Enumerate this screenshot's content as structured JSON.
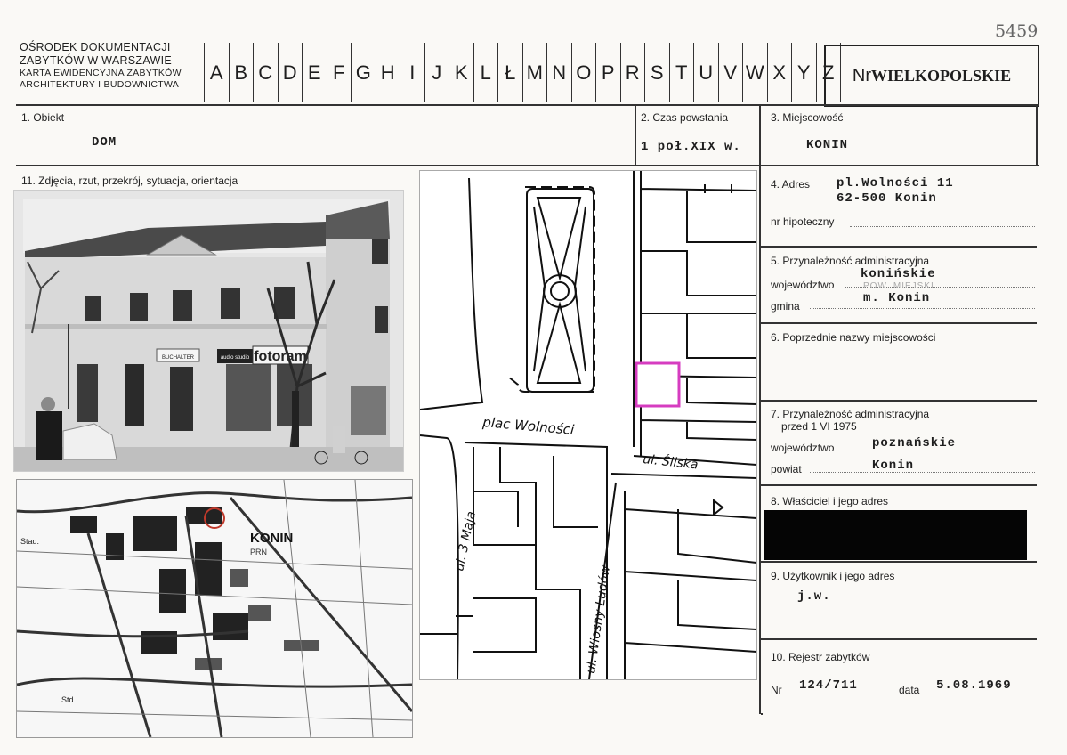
{
  "corner_number": "5459",
  "header": {
    "institution_line1": "OŚRODEK DOKUMENTACJI",
    "institution_line2": "ZABYTKÓW W WARSZAWIE",
    "institution_line3": "KARTA EWIDENCYJNA ZABYTKÓW",
    "institution_line4": "ARCHITEKTURY I BUDOWNICTWA",
    "letters": [
      "A",
      "B",
      "C",
      "D",
      "E",
      "F",
      "G",
      "H",
      "I",
      "J",
      "K",
      "L",
      "Ł",
      "M",
      "N",
      "O",
      "P",
      "R",
      "S",
      "T",
      "U",
      "V",
      "W",
      "X",
      "Y",
      "Z"
    ],
    "nr_label": "Nr",
    "nr_value": "WIELKOPOLSKIE"
  },
  "fields": {
    "obiekt_label": "1. Obiekt",
    "obiekt_value": "DOM",
    "czas_label": "2. Czas powstania",
    "czas_value": "1 poł.XIX w.",
    "miejscowosc_label": "3. Miejscowość",
    "miejscowosc_value": "KONIN",
    "zdjecia_label": "11. Zdjęcia, rzut, przekrój, sytuacja, orientacja",
    "adres_label": "4. Adres",
    "adres_line1": "pl.Wolności 11",
    "adres_line2": "62-500 Konin",
    "hipoteczny_label": "nr hipoteczny",
    "admin_label": "5. Przynależność administracyjna",
    "wojewodztwo_label": "województwo",
    "wojewodztwo_value": "konińskie",
    "gmina_label": "gmina",
    "gmina_note": "POW. MIEJSKI",
    "gmina_value": "m. Konin",
    "poprzednie_label": "6. Poprzednie nazwy miejscowości",
    "admin75_label_line1": "7. Przynależność administracyjna",
    "admin75_label_line2": "przed 1 VI 1975",
    "wojewodztwo75_label": "województwo",
    "wojewodztwo75_value": "poznańskie",
    "powiat_label": "powiat",
    "powiat_value": "Konin",
    "wlasciciel_label": "8. Właściciel i jego adres",
    "uzytkownik_label": "9. Użytkownik i jego adres",
    "uzytkownik_value": "j.w.",
    "rejestr_label": "10. Rejestr zabytków",
    "nr_label": "Nr",
    "nr_value": "124/711",
    "data_label": "data",
    "data_value": "5.08.1969"
  },
  "photo": {
    "sign_left": "BUCHALTER",
    "sign_audio": "audio studio",
    "sign_foto": "fotoram"
  },
  "city_map": {
    "town_name": "KONIN",
    "town_sub": "PRN",
    "label_stad": "Stad.",
    "label_std": "Std."
  },
  "plan": {
    "square_label": "plac Wolności",
    "street_sliska": "ul. Śliska",
    "street_3maja": "ul. 3 Maja",
    "street_wiosny": "ul. Wiosny Ludów"
  },
  "colors": {
    "highlight": "#d63cc0",
    "map_circle": "#c0392b"
  }
}
